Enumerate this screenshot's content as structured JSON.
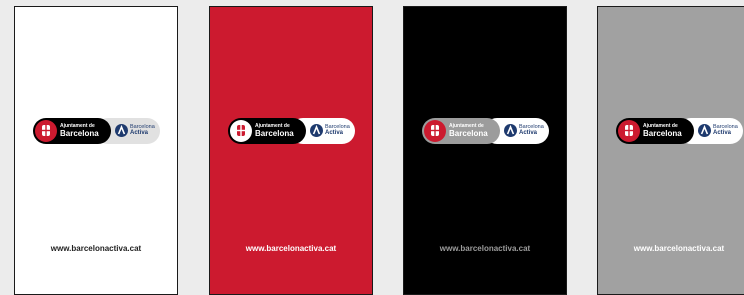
{
  "colors": {
    "page_background": "#ececec",
    "panel_white": "#ffffff",
    "panel_red": "#cc1a2f",
    "panel_black": "#000000",
    "panel_grey": "#a1a1a1",
    "activa_blue": "#1e3a6e"
  },
  "panels": [
    {
      "background_name": "white",
      "logo": {
        "ajuntament": "Ajuntament de",
        "city": "Barcelona",
        "ba_barcelona": "Barcelona",
        "ba_activa": "Activa"
      },
      "url": "www.barcelonactiva.cat"
    },
    {
      "background_name": "red",
      "logo": {
        "ajuntament": "Ajuntament de",
        "city": "Barcelona",
        "ba_barcelona": "Barcelona",
        "ba_activa": "Activa"
      },
      "url": "www.barcelonactiva.cat"
    },
    {
      "background_name": "black",
      "logo": {
        "ajuntament": "Ajuntament de",
        "city": "Barcelona",
        "ba_barcelona": "Barcelona",
        "ba_activa": "Activa"
      },
      "url": "www.barcelonactiva.cat"
    },
    {
      "background_name": "grey",
      "logo": {
        "ajuntament": "Ajuntament de",
        "city": "Barcelona",
        "ba_barcelona": "Barcelona",
        "ba_activa": "Activa"
      },
      "url": "www.barcelonactiva.cat"
    }
  ]
}
